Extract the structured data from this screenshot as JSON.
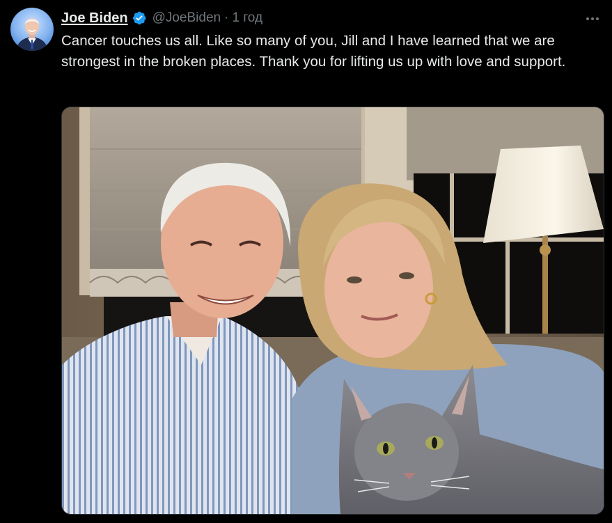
{
  "tweet": {
    "author_name": "Joe Biden",
    "handle": "@JoeBiden",
    "separator": "·",
    "timestamp": "1 год",
    "text": "Cancer touches us all. Like so many of you, Jill and I have learned that we are strongest in the broken places. Thank you for lifting us up with love and support.",
    "verified_badge_color": "#1d9bf0"
  },
  "icons": {
    "verified": "verified-badge-icon",
    "more": "more-options-icon"
  }
}
